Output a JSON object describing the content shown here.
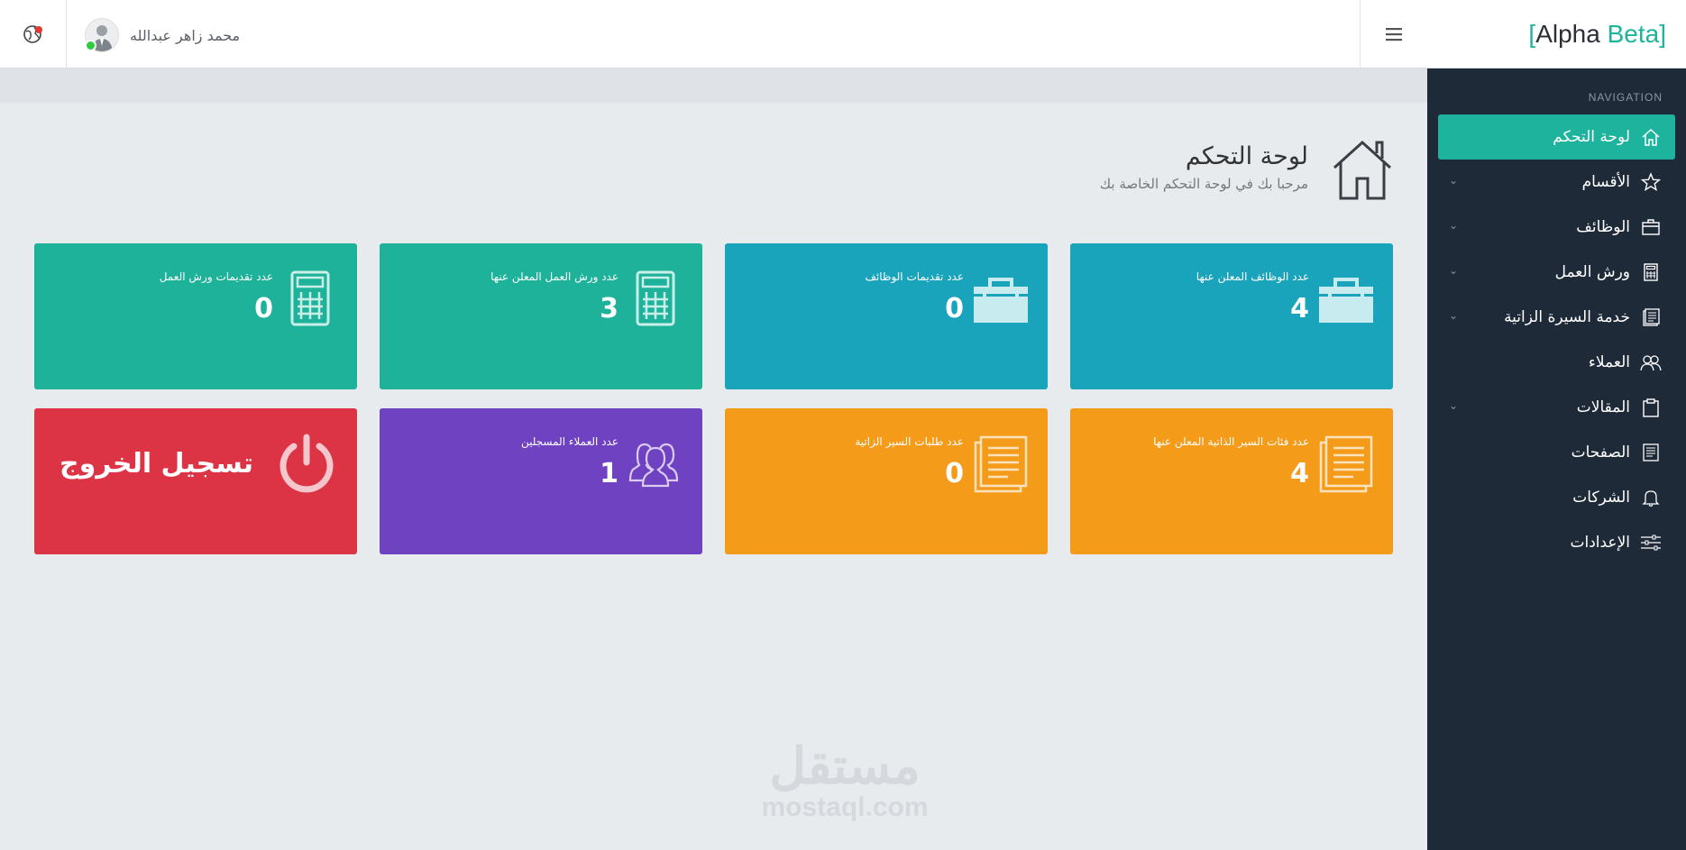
{
  "brand": {
    "bracket_open": "[",
    "part1": "Alpha",
    "part2": "Beta",
    "bracket_close": "]"
  },
  "user": {
    "name": "محمد زاهر عبدالله"
  },
  "colors": {
    "teal": "#1eb29a",
    "blue": "#19a4bc",
    "orange": "#f49b1a",
    "purple": "#6f42c1",
    "red": "#dc3444",
    "sidebar": "#1f2a38"
  },
  "sidebar": {
    "nav_label": "NAVIGATION",
    "items": [
      {
        "label": "لوحة التحكم",
        "icon": "home-icon",
        "active": true
      },
      {
        "label": "الأقسام",
        "icon": "star-icon"
      },
      {
        "label": "الوظائف",
        "icon": "briefcase-icon"
      },
      {
        "label": "ورش العمل",
        "icon": "calculator-icon"
      },
      {
        "label": "خدمة السيرة الزاتية",
        "icon": "document-icon"
      },
      {
        "label": "العملاء",
        "icon": "users-icon"
      },
      {
        "label": "المقالات",
        "icon": "clipboard-icon"
      },
      {
        "label": "الصفحات",
        "icon": "page-icon"
      },
      {
        "label": "الشركات",
        "icon": "bell-icon"
      },
      {
        "label": "الإعدادات",
        "icon": "sliders-icon"
      }
    ]
  },
  "page": {
    "title": "لوحة التحكم",
    "subtitle": "مرحبا بك في لوحة التحكم الخاصة بك"
  },
  "cards": {
    "jobs": {
      "label": "عدد الوظائف المعلن عنها",
      "value": "4",
      "icon": "briefcase-icon"
    },
    "job_apps": {
      "label": "عدد تقديمات الوظائف",
      "value": "0",
      "icon": "briefcase-icon"
    },
    "workshops": {
      "label": "عدد ورش العمل المعلن عنها",
      "value": "3",
      "icon": "calculator-icon"
    },
    "workshop_apps": {
      "label": "عدد تقديمات ورش العمل",
      "value": "0",
      "icon": "calculator-icon"
    },
    "cv_categories": {
      "label": "عدد فئات السير الذاتية المعلن عنها",
      "value": "4",
      "icon": "document-icon"
    },
    "cv_requests": {
      "label": "عدد طلبات السير الزاتية",
      "value": "0",
      "icon": "document-icon"
    },
    "clients": {
      "label": "عدد العملاء المسجلين",
      "value": "1",
      "icon": "users-icon"
    },
    "logout": {
      "label": "تسجيل الخروج",
      "icon": "power-icon"
    }
  },
  "watermark": {
    "arabic": "مستقل",
    "latin": "mostaql.com"
  }
}
